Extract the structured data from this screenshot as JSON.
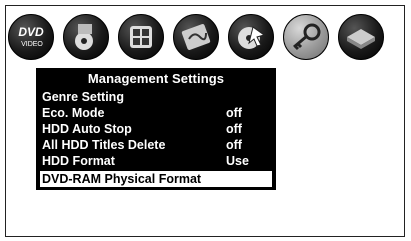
{
  "icons": [
    {
      "name": "dvd-video-icon",
      "text_top": "DVD",
      "text_bottom": "VIDEO",
      "selected": false
    },
    {
      "name": "music-icon",
      "selected": false
    },
    {
      "name": "picture-icon",
      "selected": false
    },
    {
      "name": "edit-icon",
      "selected": false
    },
    {
      "name": "disc-setup-icon",
      "selected": false
    },
    {
      "name": "key-management-icon",
      "selected": true
    },
    {
      "name": "drive-icon",
      "selected": false
    }
  ],
  "menu": {
    "title": "Management Settings",
    "items": [
      {
        "label": "Genre Setting",
        "value": ""
      },
      {
        "label": "Eco. Mode",
        "value": "off"
      },
      {
        "label": "HDD Auto Stop",
        "value": "off"
      },
      {
        "label": "All HDD Titles Delete",
        "value": "off"
      },
      {
        "label": "HDD Format",
        "value": "Use"
      },
      {
        "label": "DVD-RAM Physical Format",
        "value": ""
      }
    ],
    "highlighted_index": 5
  },
  "colors": {
    "menu_bg": "#000000",
    "menu_text": "#ffffff",
    "highlight_bg": "#ffffff"
  }
}
